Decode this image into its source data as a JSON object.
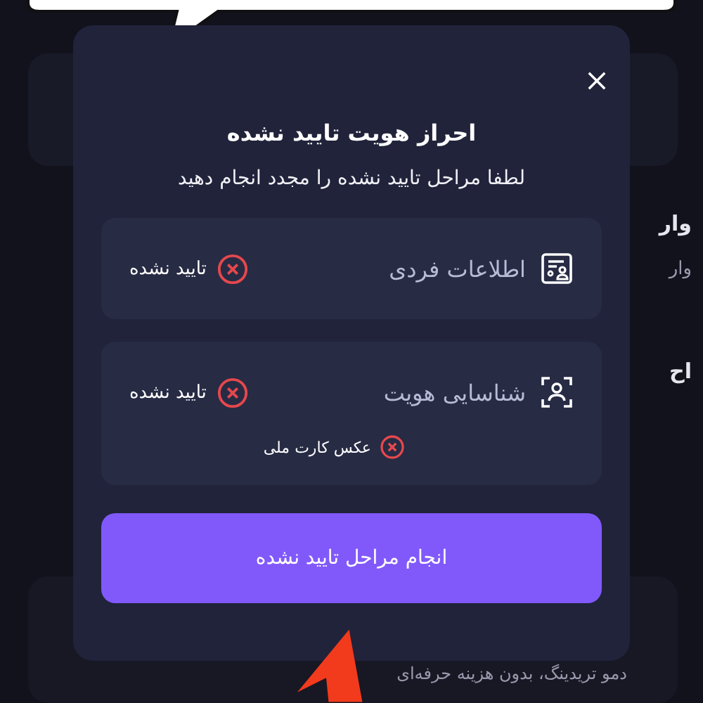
{
  "background": {
    "side_texts": [
      {
        "text": "وار",
        "kind": "title"
      },
      {
        "text": "وار",
        "kind": "subtitle"
      },
      {
        "text": "اح",
        "kind": "title"
      }
    ],
    "footer_text": "دمو تریدینگ، بدون هزینه حرفه‌ای"
  },
  "modal": {
    "title": "احراز هویت تایید نشده",
    "subtitle": "لطفا مراحل تایید نشده را مجدد انجام دهید",
    "steps": [
      {
        "kind": "form",
        "label": "اطلاعات فردی",
        "status": "تایید نشده",
        "verified": false
      },
      {
        "kind": "face",
        "label": "شناسایی هویت",
        "status": "تایید نشده",
        "verified": false,
        "children": [
          {
            "label": "عکس کارت ملی",
            "verified": false
          }
        ]
      }
    ],
    "button": "انجام مراحل تایید نشده"
  }
}
